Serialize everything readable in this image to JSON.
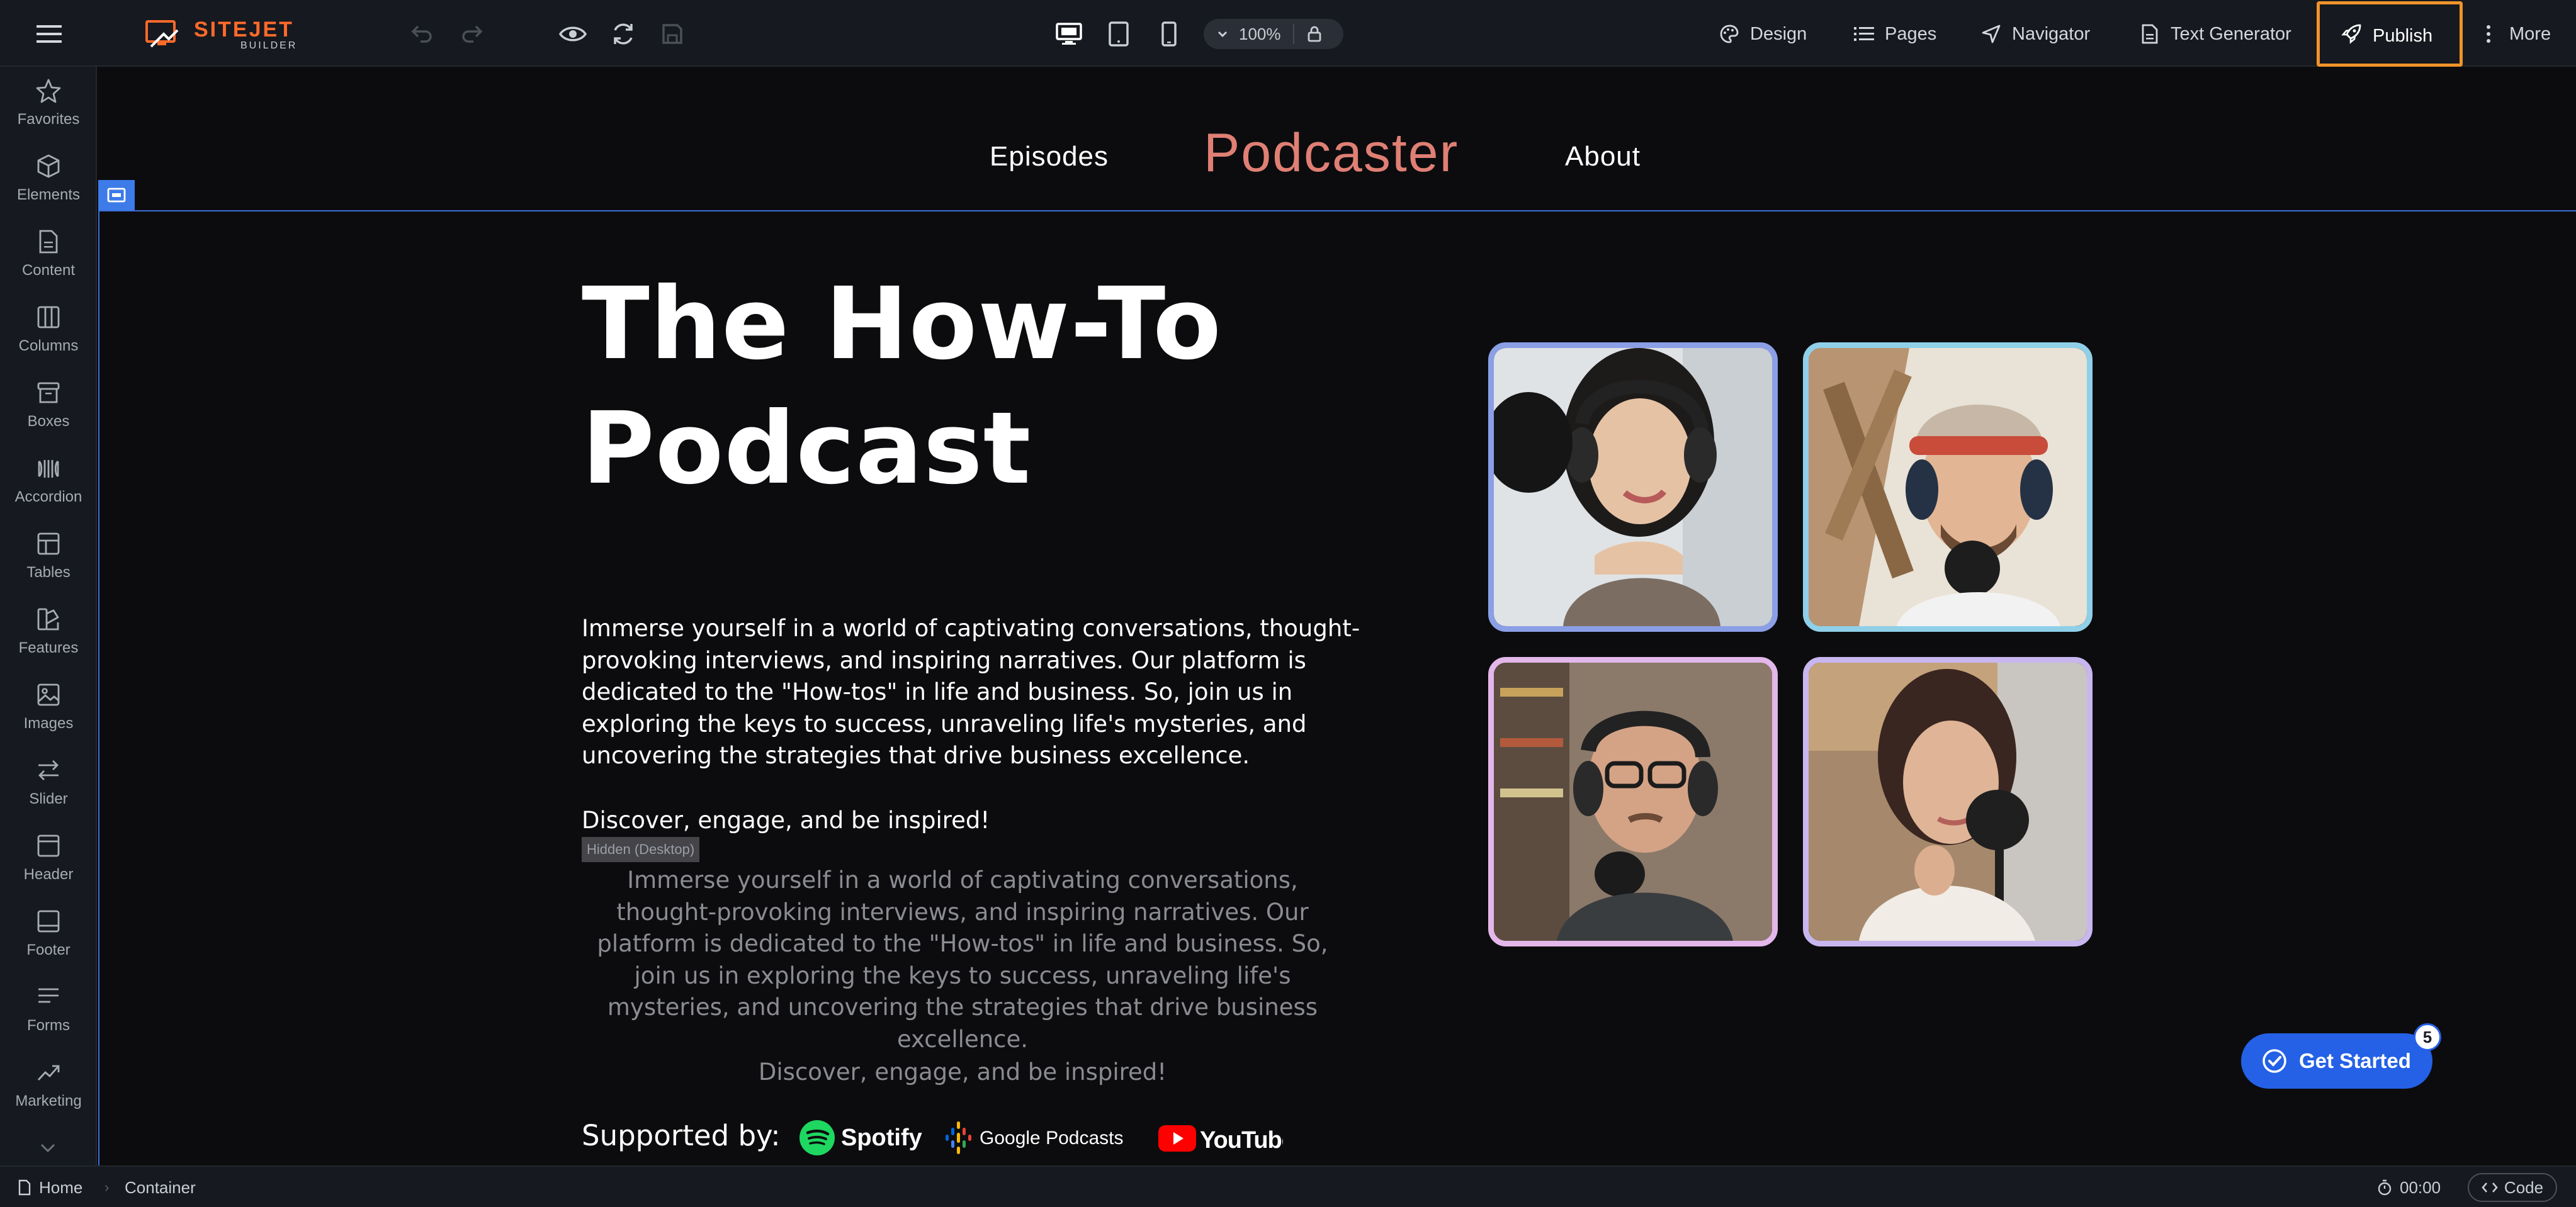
{
  "app": {
    "logo_text": "SITEJET",
    "logo_subtext": "BUILDER"
  },
  "toolbar": {
    "zoom": "100%",
    "design": "Design",
    "pages": "Pages",
    "navigator": "Navigator",
    "text_generator": "Text Generator",
    "publish": "Publish",
    "more": "More",
    "accent": "#f0932b"
  },
  "sidebar": {
    "items": [
      {
        "label": "Favorites",
        "icon": "star-icon"
      },
      {
        "label": "Elements",
        "icon": "cube-icon"
      },
      {
        "label": "Content",
        "icon": "document-icon"
      },
      {
        "label": "Columns",
        "icon": "columns-icon"
      },
      {
        "label": "Boxes",
        "icon": "box-icon"
      },
      {
        "label": "Accordion",
        "icon": "accordion-icon"
      },
      {
        "label": "Tables",
        "icon": "table-icon"
      },
      {
        "label": "Features",
        "icon": "features-icon"
      },
      {
        "label": "Images",
        "icon": "image-icon"
      },
      {
        "label": "Slider",
        "icon": "slider-icon"
      },
      {
        "label": "Header",
        "icon": "header-icon"
      },
      {
        "label": "Footer",
        "icon": "footer-icon"
      },
      {
        "label": "Forms",
        "icon": "forms-icon"
      },
      {
        "label": "Marketing",
        "icon": "trend-icon"
      }
    ]
  },
  "site": {
    "nav": {
      "episodes": "Episodes",
      "brand": "Podcaster",
      "about": "About",
      "brand_color": "#e07f74"
    },
    "hero": {
      "title_line1": "The How-To",
      "title_line2": "Podcast",
      "body": "Immerse yourself in a world of captivating conversations, thought-provoking interviews, and inspiring narratives. Our platform is dedicated to the \"How-tos\" in life and business. So, join us in exploring the keys to success, unraveling life's mysteries, and uncovering the strategies that drive business excellence.",
      "tagline": "Discover, engage, and be inspired!",
      "hidden_badge": "Hidden (Desktop)",
      "ghost_body": "Immerse yourself in a world of captivating conversations, thought-provoking interviews, and inspiring narratives. Our platform is dedicated to the \"How-tos\" in life and business. So, join us in exploring the keys to success, unraveling life's mysteries, and uncovering the strategies that drive business excellence.",
      "ghost_tagline": "Discover, engage, and be inspired!",
      "supported_by": "Supported by:",
      "partners": {
        "spotify": "Spotify",
        "google_podcasts": "Google Podcasts",
        "youtube": "YouTube"
      }
    }
  },
  "get_started": {
    "label": "Get Started",
    "badge": "5"
  },
  "status": {
    "breadcrumb_home": "Home",
    "breadcrumb_current": "Container",
    "timer": "00:00",
    "code": "Code"
  }
}
